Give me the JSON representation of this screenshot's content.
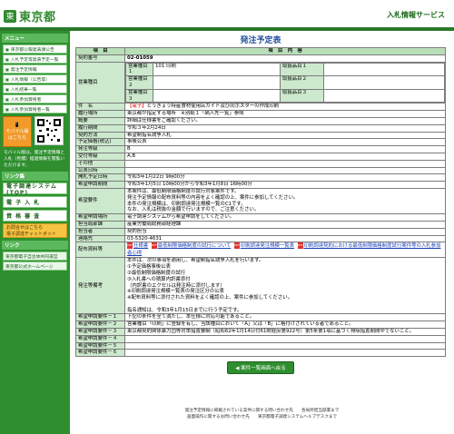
{
  "header": {
    "logo_mark": "東",
    "logo_text": "東京都",
    "service_title": "入札情報サービス"
  },
  "sidebar": {
    "menu_head": "メニュー",
    "items": [
      {
        "label": "東京都公報発表課公告"
      },
      {
        "label": "入札予定等発表予定一覧"
      },
      {
        "label": "発注予定情報"
      },
      {
        "label": "入札情報（公告等）"
      },
      {
        "label": "入札結果一覧"
      },
      {
        "label": "入札参加資格者"
      },
      {
        "label": "入札参加資格者一覧"
      }
    ],
    "mobile_label": "モバイル版",
    "mobile_sub": "はこちら",
    "mobile_note": "モバイル版は、発注予定情報と入札（見積）経過情報を閲覧いただけます。",
    "links_head": "リンク集",
    "big_items": [
      {
        "label": "電子調達システム(TOP)"
      },
      {
        "label": "電 子 入 札"
      },
      {
        "label": "資 格 審 査"
      }
    ],
    "orange_line1": "お問合せはこちら",
    "orange_line2": "電子調達チャットボット",
    "rel_head": "リンク",
    "rel_items": [
      {
        "label": "東京都電子自治体共同運営"
      },
      {
        "label": "東京都公式ホームページ"
      }
    ]
  },
  "page_title": "発注予定表",
  "table_header": {
    "col1": "項　目",
    "col2": "項　目　内　容"
  },
  "rows": {
    "contract_no": {
      "label": "契約番号",
      "value": "02-01059"
    },
    "business": {
      "label": "営業種目",
      "items": [
        {
          "name": "営業種目１",
          "value": "101 印刷",
          "sub_name": "取扱品目１",
          "sub_value": ""
        },
        {
          "name": "営業種目２",
          "value": "",
          "sub_name": "取扱品目２",
          "sub_value": ""
        },
        {
          "name": "営業種目３",
          "value": "",
          "sub_name": "取扱品目３",
          "sub_value": ""
        }
      ]
    },
    "subject": {
      "label": "件　名",
      "prefix": "【電子】",
      "value": "とうきょう特産食材使用店ガイド及び同ポスターの作成印刷"
    },
    "place": {
      "label": "履行場所",
      "value": "東京都が指定する場所　※別紙１「納入先一覧」参照"
    },
    "outline": {
      "label": "概要",
      "value": "詳細は仕様書をご確認ください。"
    },
    "period": {
      "label": "履行期間",
      "value": "令和３年2月24日"
    },
    "method": {
      "label": "契約方法",
      "value": "希望制指名競争入札"
    },
    "price": {
      "label": "予定価格(税込)",
      "value": "事後公表"
    },
    "rank": {
      "label": "発注等級",
      "value": "B"
    },
    "grade": {
      "label": "受付等級",
      "value": "A,B"
    },
    "other": {
      "label": "その他",
      "value": ""
    },
    "pub_date": {
      "label": "公表日時",
      "value": ""
    },
    "open_date": {
      "label": "開札予定日時",
      "value": "令和3年1月22日 9時00分"
    },
    "apply_period": {
      "label": "希望申請期間",
      "value": "令和3年1月5日 10時00分から令和3年1月8日 16時00分"
    },
    "apply_req": {
      "label": "希望要件",
      "lines": [
        "本案件は、最低制限価格制度の試行対象案件です。",
        "発注予定情報の配布資料等の内容をよく確認の上、案件に参加してください。",
        "本件の発注規模は、印刷調達発注規模一覧のC1です。",
        "なお、入札は税抜の金額で行いますので、ご注意ください。"
      ]
    },
    "apply_place": {
      "label": "希望申請場所",
      "value": "電子調達システムから希望申請をしてください。"
    },
    "section": {
      "label": "担当局部課",
      "value": "産業労働局総務部経理課"
    },
    "person": {
      "label": "担当者",
      "value": "契約担当"
    },
    "contact": {
      "label": "連絡先",
      "value": "03-5320-4631"
    },
    "docs": {
      "label": "配布資料等",
      "links": [
        {
          "text": "仕様書"
        },
        {
          "text": "最低制限価格制度の試行について"
        },
        {
          "text": "印刷調達発注規模一覧表"
        },
        {
          "text": "印刷調達契約における最低制限価格制度試行案件等の入札参加者心得"
        }
      ]
    },
    "remarks": {
      "label": "発注等備考",
      "lines": [
        "本件は、次の事項を適用し、希望制指名競争入札を行います。",
        "①予定価格事後公表",
        "②最低制限価格制度の試行",
        "③入札書への積算内訳書添付",
        "（内訳書のエクセルは発注時に添付します）",
        "※印刷調達発注規模一覧表の発注区分の公表",
        "※配布資料等に添付された資料をよく確認の上、案件に参加してください。",
        "",
        "指名通知は、令和3年1月15日までに行う予定です。"
      ]
    },
    "req1": {
      "label": "希望申請要件－１",
      "value": "下記の条件を全て満たし、本仕様に対応可能であること。"
    },
    "req2": {
      "label": "希望申請要件－２",
      "value": "営業種目「印刷」に登録を有し、当該種目において「A」又は「B」に格付けされている者であること。"
    },
    "req3": {
      "label": "希望申請要件－３",
      "value": "東京都契約関係暴力団等対策措置要綱（昭和62年1月14日付61財経庶第922号）第5条第1項に基づく排除措置期間中でないこと。"
    },
    "req4": {
      "label": "希望申請要件－４",
      "value": ""
    },
    "req5": {
      "label": "希望申請要件－５",
      "value": ""
    },
    "req6": {
      "label": "希望申請要件－６",
      "value": ""
    }
  },
  "back_button": "◀ 案件一覧画面へ戻る",
  "footer": {
    "line1": "発注予定情報に掲載されている案件に関する問い合わせ先　　各局所担当部署まで",
    "line2": "画面操作に関するお問い合わせ先　　東京都電子調達システムヘルプデスクまで"
  },
  "colors": {
    "brand_green": "#2f8f2f",
    "label_bg": "#cde9cd",
    "header_bg": "#b9dfb9",
    "title_blue": "#1e4f9e"
  }
}
